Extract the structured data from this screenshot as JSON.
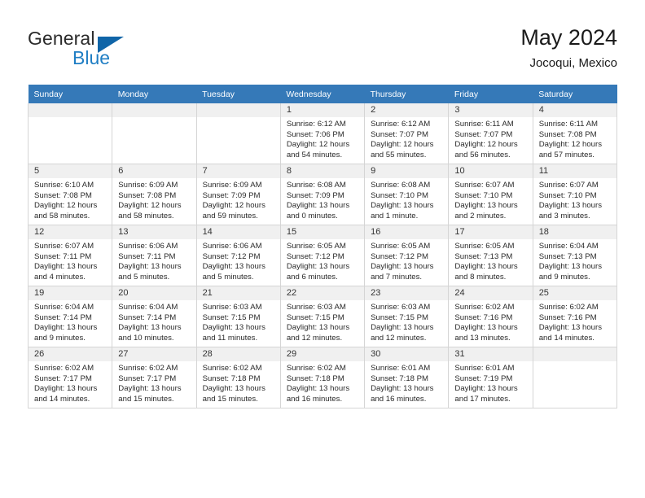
{
  "brand": {
    "name_top": "General",
    "name_bottom": "Blue",
    "triangle_color": "#1065a8",
    "blue_color": "#1f7ec4"
  },
  "header": {
    "title": "May 2024",
    "subtitle": "Jocoqui, Mexico",
    "header_bg": "#3579b8",
    "header_text_color": "#ffffff"
  },
  "weekdays": [
    "Sunday",
    "Monday",
    "Tuesday",
    "Wednesday",
    "Thursday",
    "Friday",
    "Saturday"
  ],
  "weeks": [
    [
      {
        "day": "",
        "sunrise": "",
        "sunset": "",
        "daylight1": "",
        "daylight2": ""
      },
      {
        "day": "",
        "sunrise": "",
        "sunset": "",
        "daylight1": "",
        "daylight2": ""
      },
      {
        "day": "",
        "sunrise": "",
        "sunset": "",
        "daylight1": "",
        "daylight2": ""
      },
      {
        "day": "1",
        "sunrise": "Sunrise: 6:12 AM",
        "sunset": "Sunset: 7:06 PM",
        "daylight1": "Daylight: 12 hours",
        "daylight2": "and 54 minutes."
      },
      {
        "day": "2",
        "sunrise": "Sunrise: 6:12 AM",
        "sunset": "Sunset: 7:07 PM",
        "daylight1": "Daylight: 12 hours",
        "daylight2": "and 55 minutes."
      },
      {
        "day": "3",
        "sunrise": "Sunrise: 6:11 AM",
        "sunset": "Sunset: 7:07 PM",
        "daylight1": "Daylight: 12 hours",
        "daylight2": "and 56 minutes."
      },
      {
        "day": "4",
        "sunrise": "Sunrise: 6:11 AM",
        "sunset": "Sunset: 7:08 PM",
        "daylight1": "Daylight: 12 hours",
        "daylight2": "and 57 minutes."
      }
    ],
    [
      {
        "day": "5",
        "sunrise": "Sunrise: 6:10 AM",
        "sunset": "Sunset: 7:08 PM",
        "daylight1": "Daylight: 12 hours",
        "daylight2": "and 58 minutes."
      },
      {
        "day": "6",
        "sunrise": "Sunrise: 6:09 AM",
        "sunset": "Sunset: 7:08 PM",
        "daylight1": "Daylight: 12 hours",
        "daylight2": "and 58 minutes."
      },
      {
        "day": "7",
        "sunrise": "Sunrise: 6:09 AM",
        "sunset": "Sunset: 7:09 PM",
        "daylight1": "Daylight: 12 hours",
        "daylight2": "and 59 minutes."
      },
      {
        "day": "8",
        "sunrise": "Sunrise: 6:08 AM",
        "sunset": "Sunset: 7:09 PM",
        "daylight1": "Daylight: 13 hours",
        "daylight2": "and 0 minutes."
      },
      {
        "day": "9",
        "sunrise": "Sunrise: 6:08 AM",
        "sunset": "Sunset: 7:10 PM",
        "daylight1": "Daylight: 13 hours",
        "daylight2": "and 1 minute."
      },
      {
        "day": "10",
        "sunrise": "Sunrise: 6:07 AM",
        "sunset": "Sunset: 7:10 PM",
        "daylight1": "Daylight: 13 hours",
        "daylight2": "and 2 minutes."
      },
      {
        "day": "11",
        "sunrise": "Sunrise: 6:07 AM",
        "sunset": "Sunset: 7:10 PM",
        "daylight1": "Daylight: 13 hours",
        "daylight2": "and 3 minutes."
      }
    ],
    [
      {
        "day": "12",
        "sunrise": "Sunrise: 6:07 AM",
        "sunset": "Sunset: 7:11 PM",
        "daylight1": "Daylight: 13 hours",
        "daylight2": "and 4 minutes."
      },
      {
        "day": "13",
        "sunrise": "Sunrise: 6:06 AM",
        "sunset": "Sunset: 7:11 PM",
        "daylight1": "Daylight: 13 hours",
        "daylight2": "and 5 minutes."
      },
      {
        "day": "14",
        "sunrise": "Sunrise: 6:06 AM",
        "sunset": "Sunset: 7:12 PM",
        "daylight1": "Daylight: 13 hours",
        "daylight2": "and 5 minutes."
      },
      {
        "day": "15",
        "sunrise": "Sunrise: 6:05 AM",
        "sunset": "Sunset: 7:12 PM",
        "daylight1": "Daylight: 13 hours",
        "daylight2": "and 6 minutes."
      },
      {
        "day": "16",
        "sunrise": "Sunrise: 6:05 AM",
        "sunset": "Sunset: 7:12 PM",
        "daylight1": "Daylight: 13 hours",
        "daylight2": "and 7 minutes."
      },
      {
        "day": "17",
        "sunrise": "Sunrise: 6:05 AM",
        "sunset": "Sunset: 7:13 PM",
        "daylight1": "Daylight: 13 hours",
        "daylight2": "and 8 minutes."
      },
      {
        "day": "18",
        "sunrise": "Sunrise: 6:04 AM",
        "sunset": "Sunset: 7:13 PM",
        "daylight1": "Daylight: 13 hours",
        "daylight2": "and 9 minutes."
      }
    ],
    [
      {
        "day": "19",
        "sunrise": "Sunrise: 6:04 AM",
        "sunset": "Sunset: 7:14 PM",
        "daylight1": "Daylight: 13 hours",
        "daylight2": "and 9 minutes."
      },
      {
        "day": "20",
        "sunrise": "Sunrise: 6:04 AM",
        "sunset": "Sunset: 7:14 PM",
        "daylight1": "Daylight: 13 hours",
        "daylight2": "and 10 minutes."
      },
      {
        "day": "21",
        "sunrise": "Sunrise: 6:03 AM",
        "sunset": "Sunset: 7:15 PM",
        "daylight1": "Daylight: 13 hours",
        "daylight2": "and 11 minutes."
      },
      {
        "day": "22",
        "sunrise": "Sunrise: 6:03 AM",
        "sunset": "Sunset: 7:15 PM",
        "daylight1": "Daylight: 13 hours",
        "daylight2": "and 12 minutes."
      },
      {
        "day": "23",
        "sunrise": "Sunrise: 6:03 AM",
        "sunset": "Sunset: 7:15 PM",
        "daylight1": "Daylight: 13 hours",
        "daylight2": "and 12 minutes."
      },
      {
        "day": "24",
        "sunrise": "Sunrise: 6:02 AM",
        "sunset": "Sunset: 7:16 PM",
        "daylight1": "Daylight: 13 hours",
        "daylight2": "and 13 minutes."
      },
      {
        "day": "25",
        "sunrise": "Sunrise: 6:02 AM",
        "sunset": "Sunset: 7:16 PM",
        "daylight1": "Daylight: 13 hours",
        "daylight2": "and 14 minutes."
      }
    ],
    [
      {
        "day": "26",
        "sunrise": "Sunrise: 6:02 AM",
        "sunset": "Sunset: 7:17 PM",
        "daylight1": "Daylight: 13 hours",
        "daylight2": "and 14 minutes."
      },
      {
        "day": "27",
        "sunrise": "Sunrise: 6:02 AM",
        "sunset": "Sunset: 7:17 PM",
        "daylight1": "Daylight: 13 hours",
        "daylight2": "and 15 minutes."
      },
      {
        "day": "28",
        "sunrise": "Sunrise: 6:02 AM",
        "sunset": "Sunset: 7:18 PM",
        "daylight1": "Daylight: 13 hours",
        "daylight2": "and 15 minutes."
      },
      {
        "day": "29",
        "sunrise": "Sunrise: 6:02 AM",
        "sunset": "Sunset: 7:18 PM",
        "daylight1": "Daylight: 13 hours",
        "daylight2": "and 16 minutes."
      },
      {
        "day": "30",
        "sunrise": "Sunrise: 6:01 AM",
        "sunset": "Sunset: 7:18 PM",
        "daylight1": "Daylight: 13 hours",
        "daylight2": "and 16 minutes."
      },
      {
        "day": "31",
        "sunrise": "Sunrise: 6:01 AM",
        "sunset": "Sunset: 7:19 PM",
        "daylight1": "Daylight: 13 hours",
        "daylight2": "and 17 minutes."
      },
      {
        "day": "",
        "sunrise": "",
        "sunset": "",
        "daylight1": "",
        "daylight2": ""
      }
    ]
  ]
}
